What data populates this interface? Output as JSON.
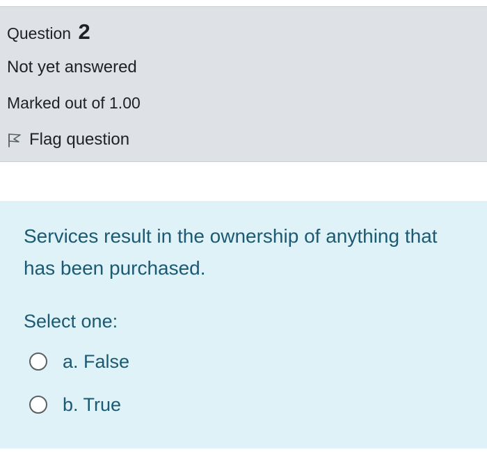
{
  "question_info": {
    "title_prefix": "Question",
    "number": "2",
    "state": "Not yet answered",
    "grade": "Marked out of 1.00",
    "flag_label": "Flag question"
  },
  "question": {
    "text": "Services result in the ownership of anything that has been purchased.",
    "prompt": "Select one:",
    "answers": [
      {
        "label": "a. False",
        "selected": false
      },
      {
        "label": "b. True",
        "selected": false
      }
    ]
  },
  "colors": {
    "info_background": "#dee2e6",
    "content_background": "#def2f8",
    "question_text": "#1b5a72"
  },
  "icons": {
    "flag": "flag-outline-icon",
    "radio": "radio-unchecked"
  }
}
